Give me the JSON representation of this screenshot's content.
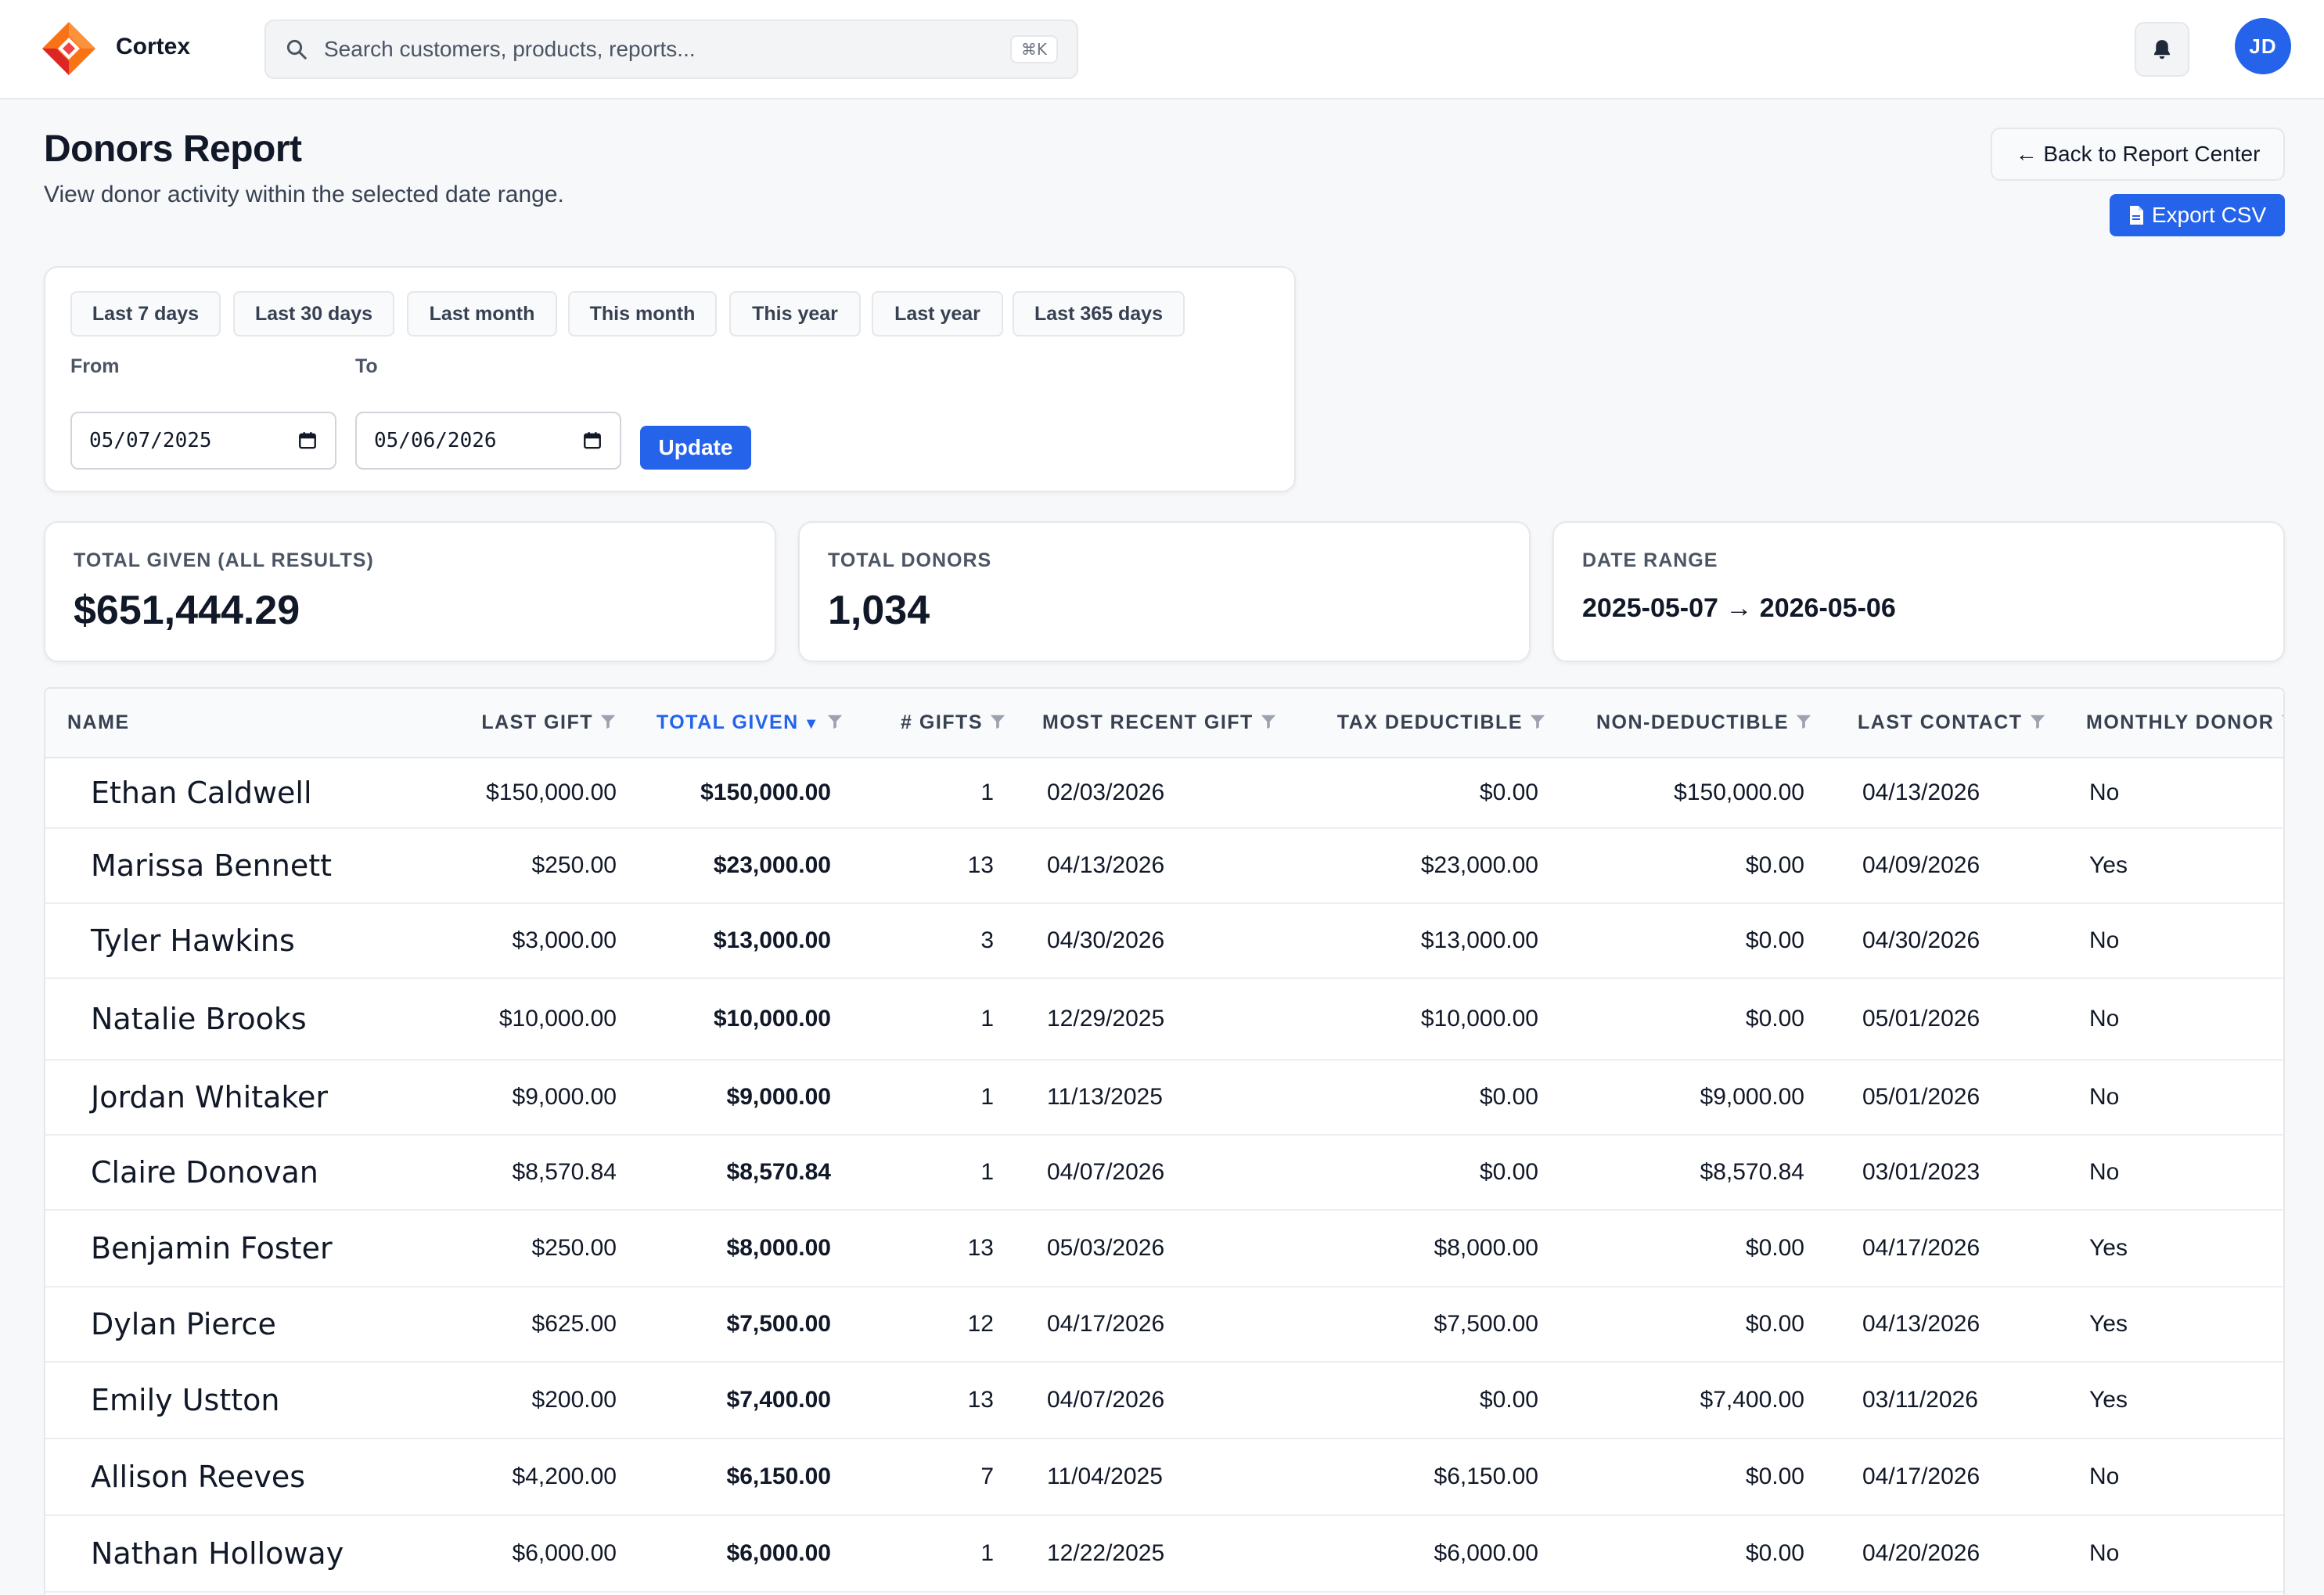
{
  "app": {
    "brand": "Cortex"
  },
  "search": {
    "placeholder": "Search customers, products, reports...",
    "shortcut": "⌘K"
  },
  "user": {
    "initials": "JD"
  },
  "page": {
    "title": "Donors Report",
    "subtitle": "View donor activity within the selected date range.",
    "back_label": "← Back to Report Center",
    "export_label": "Export CSV"
  },
  "filters": {
    "ranges": [
      "Last 7 days",
      "Last 30 days",
      "Last month",
      "This month",
      "This year",
      "Last year",
      "Last 365 days"
    ],
    "from_label": "From",
    "to_label": "To",
    "from_value": "05/07/2025",
    "to_value": "05/06/2026",
    "update_label": "Update"
  },
  "stats": [
    {
      "label": "TOTAL GIVEN (ALL RESULTS)",
      "value": "$651,444.29"
    },
    {
      "label": "TOTAL DONORS",
      "value": "1,034"
    },
    {
      "label": "DATE RANGE",
      "value": "2025-05-07 → 2026-05-06"
    }
  ],
  "table": {
    "columns": [
      "NAME",
      "LAST GIFT",
      "TOTAL GIVEN",
      "# GIFTS",
      "MOST RECENT GIFT",
      "TAX DEDUCTIBLE",
      "NON-DEDUCTIBLE",
      "LAST CONTACT",
      "MONTHLY DONOR"
    ],
    "sort_indicator": "▼",
    "rows": [
      [
        "Ethan Caldwell",
        "$150,000.00",
        "$150,000.00",
        "1",
        "02/03/2026",
        "$0.00",
        "$150,000.00",
        "04/13/2026",
        "No"
      ],
      [
        "Marissa Bennett",
        "$250.00",
        "$23,000.00",
        "13",
        "04/13/2026",
        "$23,000.00",
        "$0.00",
        "04/09/2026",
        "Yes"
      ],
      [
        "Tyler Hawkins",
        "$3,000.00",
        "$13,000.00",
        "3",
        "04/30/2026",
        "$13,000.00",
        "$0.00",
        "04/30/2026",
        "No"
      ],
      [
        "Natalie Brooks",
        "$10,000.00",
        "$10,000.00",
        "1",
        "12/29/2025",
        "$10,000.00",
        "$0.00",
        "05/01/2026",
        "No"
      ],
      [
        "Jordan Whitaker",
        "$9,000.00",
        "$9,000.00",
        "1",
        "11/13/2025",
        "$0.00",
        "$9,000.00",
        "05/01/2026",
        "No"
      ],
      [
        "Claire Donovan",
        "$8,570.84",
        "$8,570.84",
        "1",
        "04/07/2026",
        "$0.00",
        "$8,570.84",
        "03/01/2023",
        "No"
      ],
      [
        "Benjamin Foster",
        "$250.00",
        "$8,000.00",
        "13",
        "05/03/2026",
        "$8,000.00",
        "$0.00",
        "04/17/2026",
        "Yes"
      ],
      [
        "Dylan Pierce",
        "$625.00",
        "$7,500.00",
        "12",
        "04/17/2026",
        "$7,500.00",
        "$0.00",
        "04/13/2026",
        "Yes"
      ],
      [
        "Emily Ustton",
        "$200.00",
        "$7,400.00",
        "13",
        "04/07/2026",
        "$0.00",
        "$7,400.00",
        "03/11/2026",
        "Yes"
      ],
      [
        "Allison Reeves",
        "$4,200.00",
        "$6,150.00",
        "7",
        "11/04/2025",
        "$6,150.00",
        "$0.00",
        "04/17/2026",
        "No"
      ],
      [
        "Nathan Holloway",
        "$6,000.00",
        "$6,000.00",
        "1",
        "12/22/2025",
        "$6,000.00",
        "$0.00",
        "04/20/2026",
        "No"
      ]
    ]
  },
  "colors": {
    "accent": "#2563eb",
    "logo_orange": "#f97316",
    "logo_red": "#dc2626"
  },
  "icons": {
    "logo": "cortex-logo-icon",
    "search": "search-icon",
    "bell": "bell-icon",
    "export": "file-icon",
    "filter": "funnel-icon"
  }
}
